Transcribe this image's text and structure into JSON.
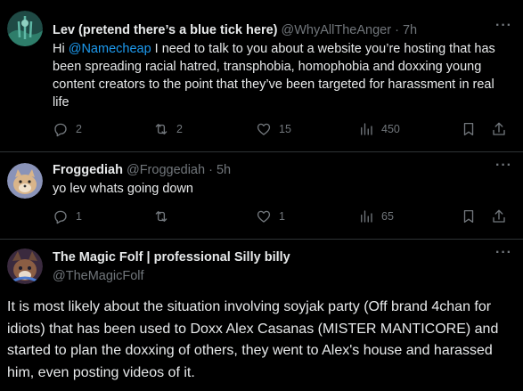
{
  "tweets": [
    {
      "name": "Lev (pretend there’s a blue tick here)",
      "handle": "@WhyAllTheAnger",
      "separator": "·",
      "time": "7h",
      "text_prefix": "Hi ",
      "mention": "@Namecheap",
      "text_rest": " I need to talk to you about a website you’re hosting that has been spreading racial hatred, transphobia, homophobia and doxxing young content creators to the point that they’ve been targeted for harassment in real life",
      "counts": {
        "replies": "2",
        "retweets": "2",
        "likes": "15",
        "views": "450"
      }
    },
    {
      "name": "Froggediah",
      "handle": "@Froggediah",
      "separator": "·",
      "time": "5h",
      "text": "yo lev whats going down",
      "counts": {
        "replies": "1",
        "retweets": "",
        "likes": "1",
        "views": "65"
      }
    },
    {
      "name": "The Magic Folf | professional Silly billy",
      "handle": "@TheMagicFolf",
      "text": "It is most likely about the situation involving soyjak party (Off brand 4chan for idiots) that has been used to Doxx Alex Casanas (MISTER MANTICORE) and started to plan the doxxing of others, they went to Alex's house and harassed him, even posting videos of it."
    }
  ],
  "icons": {
    "reply": "reply-icon",
    "retweet": "retweet-icon",
    "like": "heart-icon",
    "views": "views-chart-icon",
    "bookmark": "bookmark-icon",
    "share": "share-icon",
    "more": "more-dots-icon"
  },
  "more_glyph": "···",
  "colors": {
    "background": "#000000",
    "text": "#e7e9ea",
    "muted": "#71767b",
    "link": "#1d9bf0",
    "divider": "#2f3336"
  }
}
